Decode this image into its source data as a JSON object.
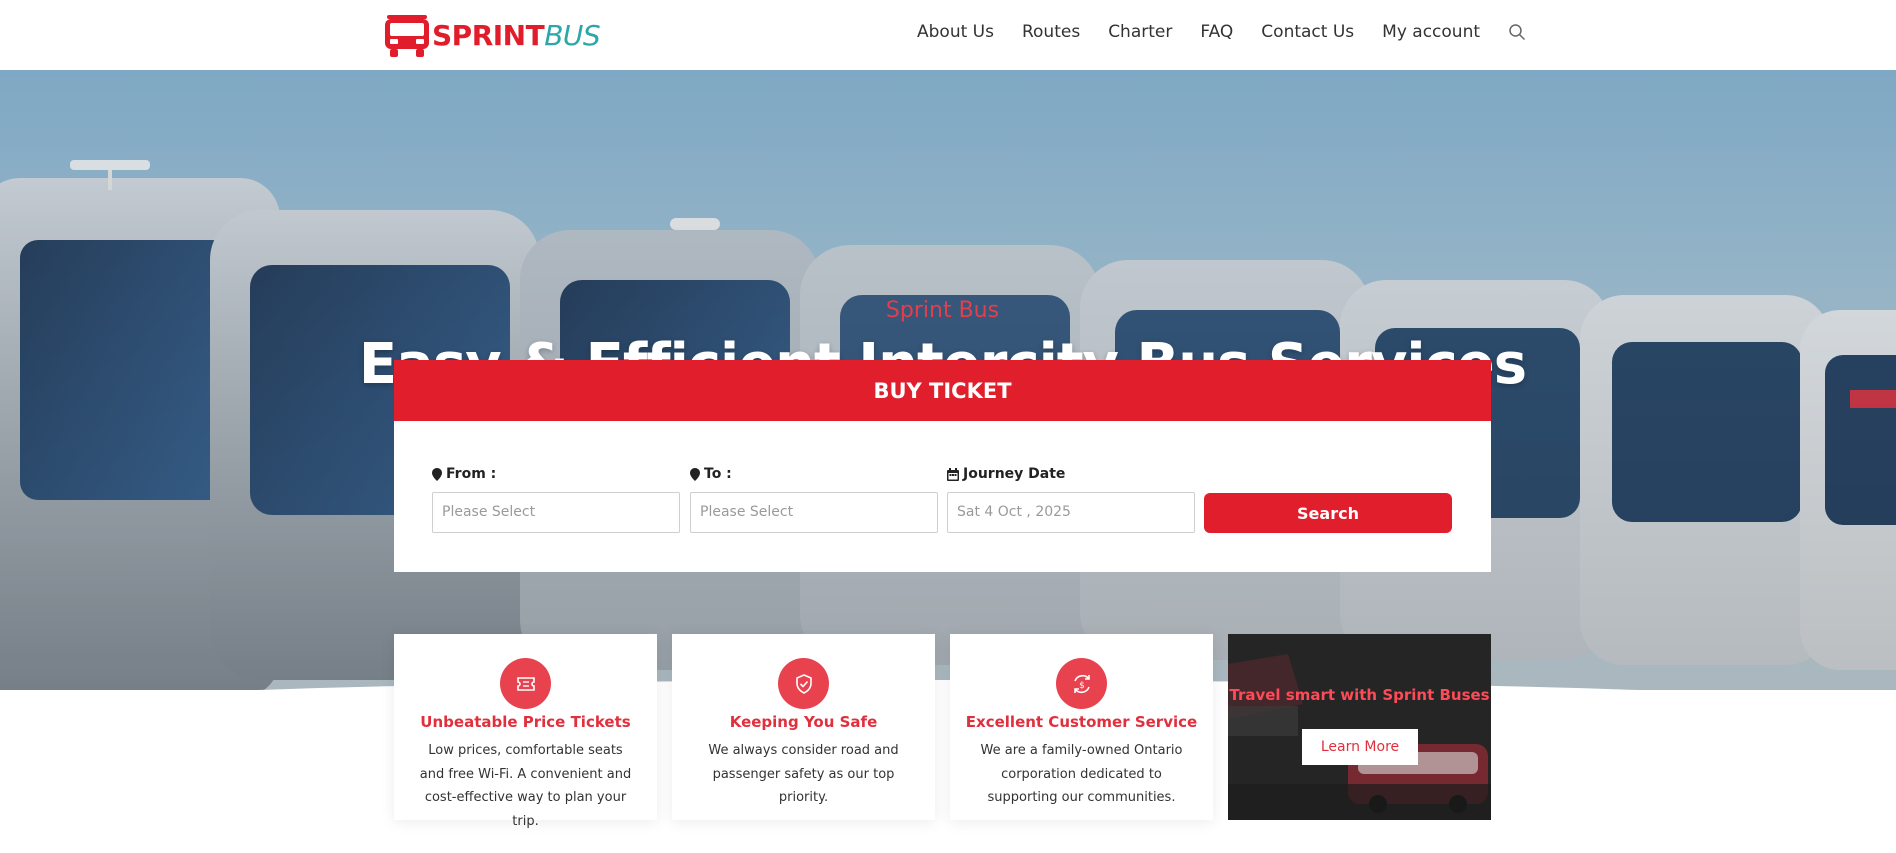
{
  "header": {
    "logo": {
      "part1": "SPRINT",
      "part2": "BUS"
    },
    "nav": [
      {
        "label": "About Us"
      },
      {
        "label": "Routes"
      },
      {
        "label": "Charter"
      },
      {
        "label": "FAQ"
      },
      {
        "label": "Contact Us"
      },
      {
        "label": "My account"
      }
    ],
    "search_icon": "search-icon"
  },
  "hero": {
    "subtitle": "Sprint Bus",
    "title": "Easy & Efficient Intercity Bus Services"
  },
  "booking": {
    "heading": "BUY TICKET",
    "from": {
      "label": "From :",
      "placeholder": "Please Select",
      "icon": "map-marker-icon"
    },
    "to": {
      "label": "To :",
      "placeholder": "Please Select",
      "icon": "map-marker-icon"
    },
    "date": {
      "label": "Journey Date",
      "placeholder": "Sat 4 Oct , 2025",
      "icon": "calendar-icon"
    },
    "search_label": "Search"
  },
  "features": [
    {
      "icon": "ticket-icon",
      "title": "Unbeatable Price Tickets",
      "text": "Low prices, comfortable seats and free Wi-Fi. A convenient and cost-effective way to plan your trip."
    },
    {
      "icon": "shield-check-icon",
      "title": "Keeping You Safe",
      "text": "We always consider road and passenger safety as our top priority."
    },
    {
      "icon": "refresh-dollar-icon",
      "title": "Excellent Customer Service",
      "text": "We are a family-owned Ontario corporation dedicated to supporting our communities."
    }
  ],
  "promo": {
    "title": "Travel smart with Sprint Buses",
    "button": "Learn More"
  },
  "colors": {
    "brand_red": "#e01e2c",
    "brand_teal": "#2aa7a7",
    "icon_red": "#e8424f"
  }
}
